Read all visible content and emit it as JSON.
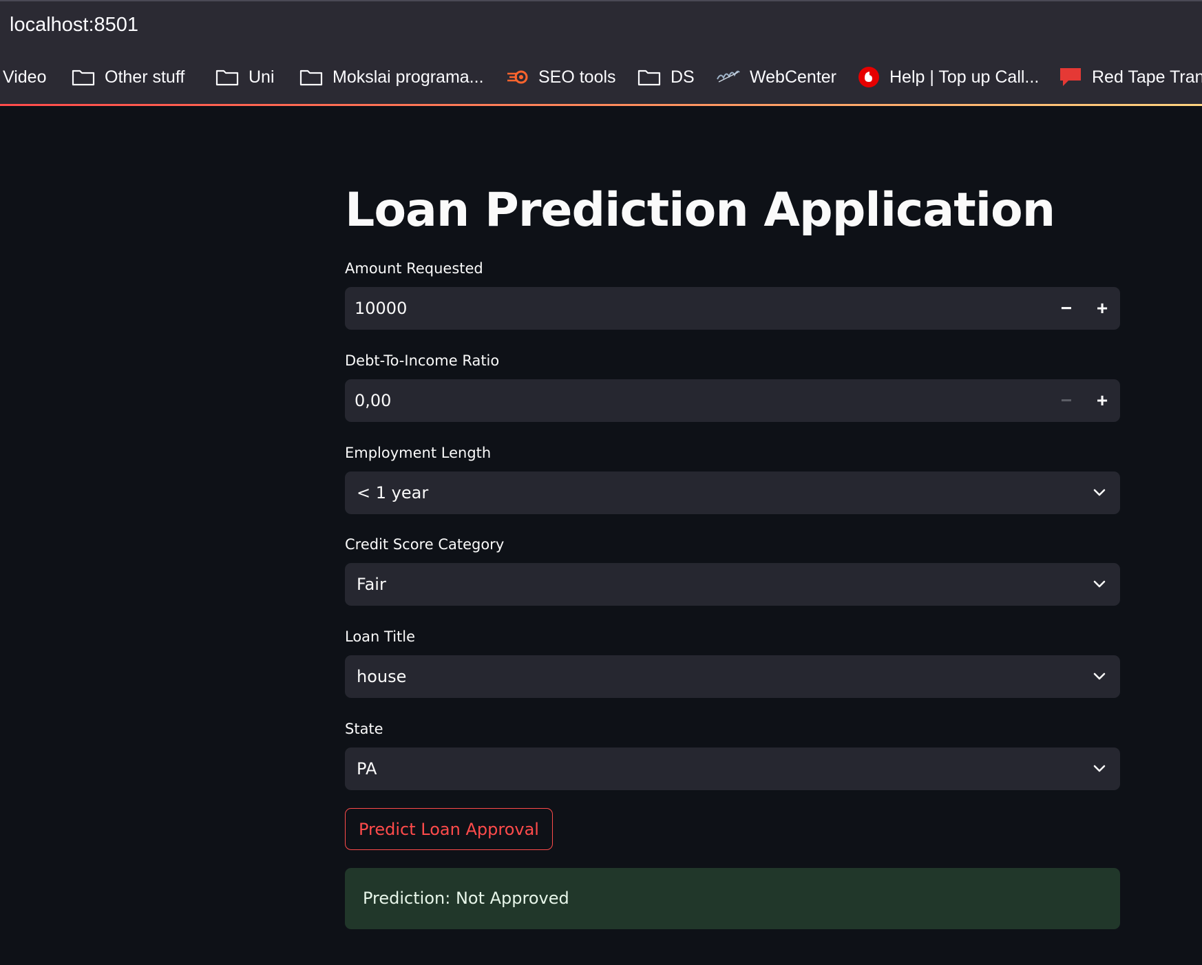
{
  "browser": {
    "url": "localhost:8501",
    "bookmarks": [
      {
        "label": "Video",
        "icon": "none"
      },
      {
        "label": "Other stuff",
        "icon": "folder-icon"
      },
      {
        "label": "Uni",
        "icon": "folder-icon"
      },
      {
        "label": "Mokslai programa...",
        "icon": "folder-icon"
      },
      {
        "label": "SEO tools",
        "icon": "semrush-icon"
      },
      {
        "label": "DS",
        "icon": "folder-icon"
      },
      {
        "label": "WebCenter",
        "icon": "webcenter-icon"
      },
      {
        "label": "Help | Top up Call...",
        "icon": "vodafone-icon"
      },
      {
        "label": "Red Tape Tran",
        "icon": "speech-bubble-icon"
      }
    ]
  },
  "app": {
    "title": "Loan Prediction Application",
    "amount": {
      "label": "Amount Requested",
      "value": "10000",
      "minus": "−",
      "plus": "+"
    },
    "dti": {
      "label": "Debt-To-Income Ratio",
      "value": "0,00",
      "minus": "−",
      "plus": "+"
    },
    "employment": {
      "label": "Employment Length",
      "value": "< 1 year"
    },
    "credit": {
      "label": "Credit Score Category",
      "value": "Fair"
    },
    "loan_title": {
      "label": "Loan Title",
      "value": "house"
    },
    "state": {
      "label": "State",
      "value": "PA"
    },
    "predict_button": "Predict Loan Approval",
    "result": "Prediction: Not Approved"
  },
  "colors": {
    "background": "#0e1117",
    "input_bg": "#262730",
    "accent": "#ff4b4b",
    "success_bg": "#21372a"
  }
}
